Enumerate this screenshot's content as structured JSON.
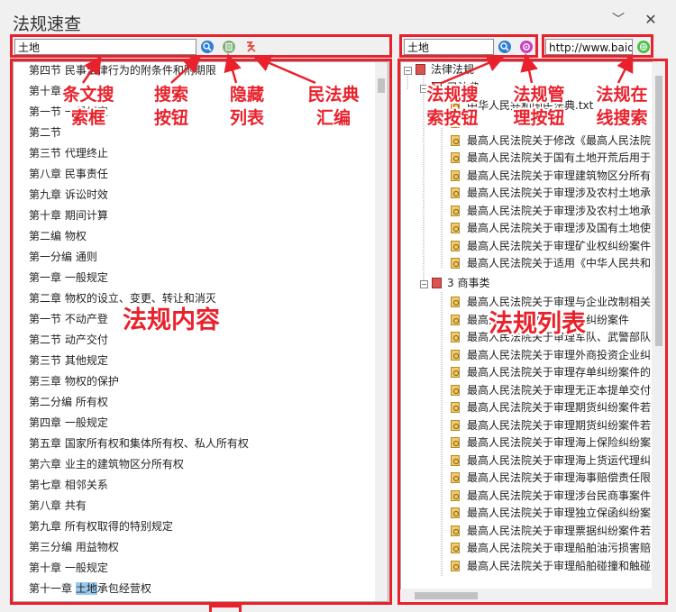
{
  "window": {
    "title": "法规速查",
    "minimize_glyph": "﹀",
    "close_glyph": "✕"
  },
  "left_toolbar": {
    "search_value": "土地",
    "search_icon": "search-icon",
    "hide_icon": "hide-list-icon",
    "civil_code_icon": "civil-code-icon"
  },
  "right_toolbar": {
    "search_value": "土地",
    "url_value": "http://www.baidu",
    "search_icon": "search-icon",
    "manage_icon": "manage-icon",
    "online_icon": "online-search-icon"
  },
  "content_lines": [
    {
      "text": "第四节 民事法律行为的附条件和附期限"
    },
    {
      "text": "第十章"
    },
    {
      "text": "第一节 一般规定"
    },
    {
      "text": "第二节"
    },
    {
      "text": "第三节 代理终止"
    },
    {
      "text": "第八章 民事责任"
    },
    {
      "text": "第九章 诉讼时效"
    },
    {
      "text": "第十章 期间计算"
    },
    {
      "text": "第二编 物权"
    },
    {
      "text": "第一分编 通则"
    },
    {
      "text": "第一章 一般规定"
    },
    {
      "text": "第二章 物权的设立、变更、转让和消灭"
    },
    {
      "text": "第一节 不动产登"
    },
    {
      "text": "第二节 动产交付"
    },
    {
      "text": "第三节 其他规定"
    },
    {
      "text": "第三章 物权的保护"
    },
    {
      "text": "第二分编 所有权"
    },
    {
      "text": "第四章 一般规定"
    },
    {
      "text": "第五章 国家所有权和集体所有权、私人所有权"
    },
    {
      "text": "第六章 业主的建筑物区分所有权"
    },
    {
      "text": "第七章 相邻关系"
    },
    {
      "text": "第八章 共有"
    },
    {
      "text": "第九章 所有权取得的特别规定"
    },
    {
      "text": "第三分编 用益物权"
    },
    {
      "text": "第十章 一般规定"
    },
    {
      "text": "第十一章 ",
      "highlight": "土地",
      "after": "承包经营权"
    }
  ],
  "tree": {
    "root_label": "法律法规",
    "node_civil_code": "民法典",
    "node_civil_code_file": "中华人民共和国民法典.txt",
    "node_group2_suffix": "类",
    "group2_items": [
      "最高人民法院关于修改《最高人民法院",
      "最高人民法院关于国有土地开荒后用于",
      "最高人民法院关于审理建筑物区分所有",
      "最高人民法院关于审理涉及农村土地承",
      "最高人民法院关于审理涉及农村土地承",
      "最高人民法院关于审理涉及国有土地使",
      "最高人民法院关于审理矿业权纠纷案件",
      "最高人民法院关于适用《中华人民共和"
    ],
    "group3_label": "3 商事类",
    "group3_items": [
      "最高人民法院关于审理与企业改制相关",
      "最高人民法院关于审理",
      "最高人民法院关于审理军队、武警部队",
      "最高人民法院关于审理外商投资企业纠",
      "最高人民法院关于审理存单纠纷案件的",
      "最高人民法院关于审理无正本提单交付",
      "最高人民法院关于审理期货纠纷案件若",
      "最高人民法院关于审理期货纠纷案件若",
      "最高人民法院关于审理海上保险纠纷案",
      "最高人民法院关于审理海上货运代理纠",
      "最高人民法院关于审理海事赔偿责任限",
      "最高人民法院关于审理涉台民商事案件",
      "最高人民法院关于审理独立保函纠纷案",
      "最高人民法院关于审理票据纠纷案件若",
      "最高人民法院关于审理船舶油污损害赔",
      "最高人民法院关于审理船舶碰撞和触碰"
    ],
    "partial_hidden": "证纠纷案件"
  },
  "annotations": {
    "search_box": "条文搜\n索框",
    "search_button": "搜索\n按钮",
    "hide_list": "隐藏\n列表",
    "civil_code": "民法典\n汇编",
    "law_search_button": "法规搜\n索按钮",
    "law_manage_button": "法规管\n理按钮",
    "law_online_search": "法规在\n线搜索",
    "law_content": "法规内容",
    "law_list": "法规列表"
  },
  "colors": {
    "annotation_red": "#e8222c",
    "highlight": "#99c9ef"
  }
}
